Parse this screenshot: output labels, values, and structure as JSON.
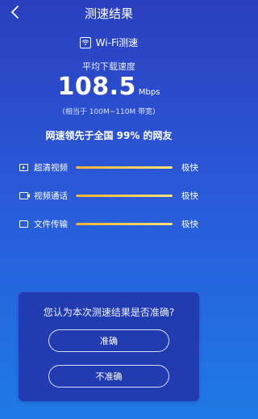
{
  "header": {
    "title": "测速结果"
  },
  "network": {
    "name": "Wi-Fi测速"
  },
  "result": {
    "avg_label": "平均下载速度",
    "speed_value": "108.5",
    "speed_unit": "Mbps",
    "equivalent": "(相当于 100M~110M 带宽)",
    "lead_text": "网速领先于全国 99% 的网友"
  },
  "rows": [
    {
      "label": "超清视频",
      "value": "极快",
      "icon": "video-play-icon",
      "fill": 1.0
    },
    {
      "label": "视频通话",
      "value": "极快",
      "icon": "video-call-icon",
      "fill": 1.0
    },
    {
      "label": "文件传输",
      "value": "极快",
      "icon": "folder-icon",
      "fill": 1.0
    }
  ],
  "feedback": {
    "question": "您认为本次测速结果是否准确?",
    "accurate_label": "准确",
    "inaccurate_label": "不准确"
  },
  "colors": {
    "bar_start": "#f3b234",
    "bar_end": "#ffe27b",
    "card": "#223bb1"
  }
}
